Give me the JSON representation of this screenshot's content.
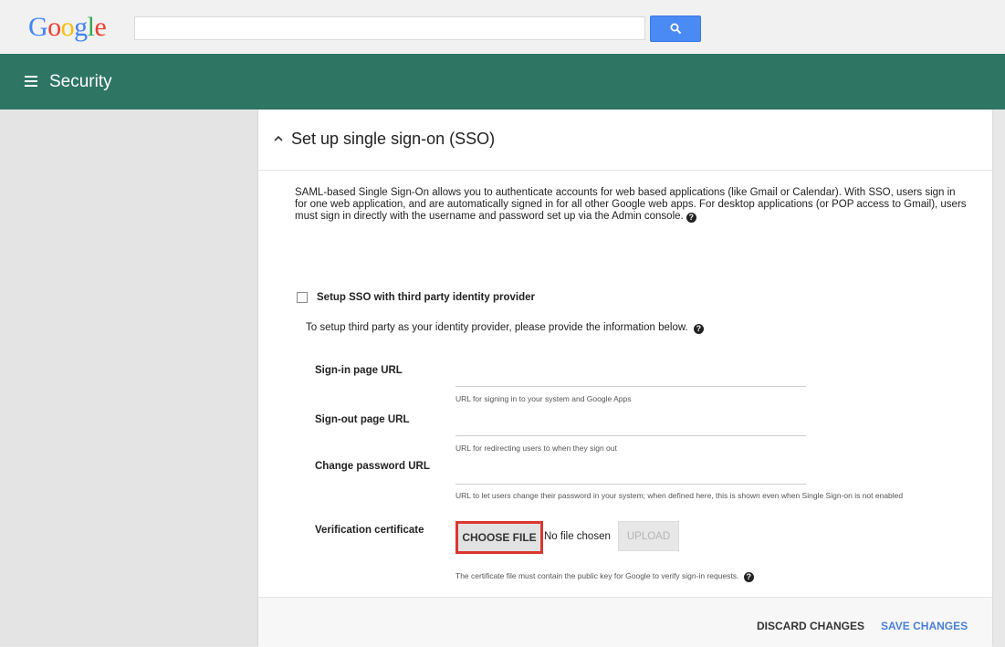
{
  "google": {
    "logo_letters": [
      "G",
      "o",
      "o",
      "g",
      "l",
      "e"
    ]
  },
  "search": {
    "value": "",
    "placeholder": "",
    "icon": "search-icon"
  },
  "header": {
    "title": "Security",
    "menu_icon": "hamburger-menu-icon"
  },
  "section": {
    "title": "Set up single sign-on (SSO)",
    "collapse_icon": "chevron-up-icon",
    "description": "SAML-based Single Sign-On allows you to authenticate accounts for web based applications (like Gmail or Calendar). With SSO, users sign in for one web application, and are automatically signed in for all other Google web apps. For desktop applications (or POP access to Gmail), users must sign in directly with the username and password set up via the Admin console."
  },
  "sso": {
    "checkbox_label": "Setup SSO with third party identity provider",
    "checked": false,
    "intro": "To setup third party as your identity provider, please provide the information below.",
    "sign_in": {
      "label": "Sign-in page URL",
      "value": "",
      "hint": "URL for signing in to your system and Google Apps"
    },
    "sign_out": {
      "label": "Sign-out page URL",
      "value": "",
      "hint": "URL for redirecting users to when they sign out"
    },
    "change_password": {
      "label": "Change password URL",
      "value": "",
      "hint": "URL to let users change their password in your system; when defined here, this is shown even when Single Sign-on is not enabled"
    },
    "certificate": {
      "label": "Verification certificate",
      "choose_label": "CHOOSE FILE",
      "no_file": "No file chosen",
      "upload_label": "UPLOAD",
      "hint": "The certificate file must contain the public key for Google to verify sign-in requests."
    }
  },
  "footer": {
    "discard_label": "DISCARD CHANGES",
    "save_label": "SAVE CHANGES"
  },
  "colors": {
    "header_green": "#2e7564",
    "search_blue": "#4a8af4",
    "highlight_red": "#d9372f",
    "save_blue": "#4a7fd6"
  }
}
